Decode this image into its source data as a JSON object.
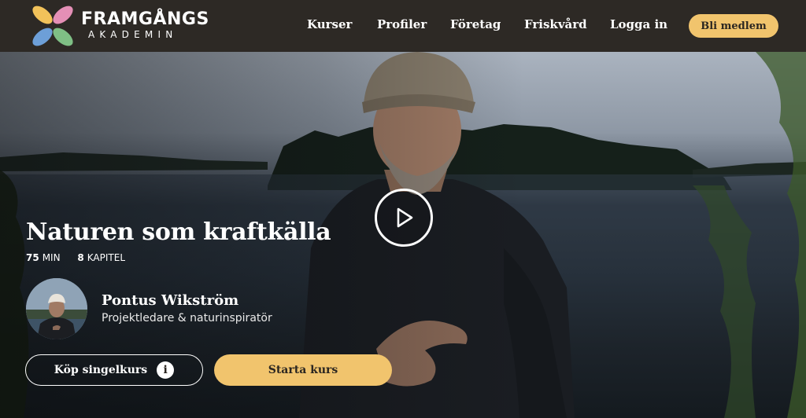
{
  "brand": {
    "name_top": "FRAMGÅNGS",
    "name_sub": "AKADEMIN"
  },
  "nav": {
    "items": [
      "Kurser",
      "Profiler",
      "Företag",
      "Friskvård",
      "Logga in"
    ],
    "cta": "Bli medlem"
  },
  "course": {
    "title": "Naturen som kraftkälla",
    "minutes": "75",
    "minutes_unit": "MIN",
    "chapters": "8",
    "chapters_unit": "KAPITEL"
  },
  "author": {
    "name": "Pontus Wikström",
    "role": "Projektledare & naturinspiratör"
  },
  "actions": {
    "buy_single": "Köp singelkurs",
    "info_glyph": "i",
    "start": "Starta kurs"
  },
  "colors": {
    "accent": "#f1c46d",
    "header_bg": "#2d2925",
    "petal_pink": "#e48fb6",
    "petal_yellow": "#f2c25a",
    "petal_blue": "#6d9fd8",
    "petal_green": "#7fbf85"
  },
  "icons": {
    "logo": "flower-logo-icon",
    "play": "play-icon",
    "info": "info-icon"
  }
}
